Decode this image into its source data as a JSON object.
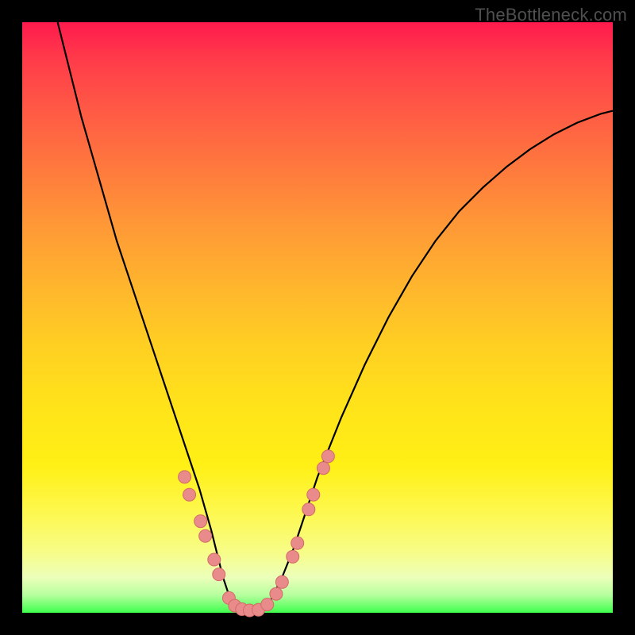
{
  "watermark": {
    "text": "TheBottleneck.com"
  },
  "colors": {
    "frame": "#000000",
    "curve_stroke": "#000000",
    "marker_fill": "#e88b8a",
    "marker_stroke": "#d46a6a"
  },
  "chart_data": {
    "type": "line",
    "title": "",
    "xlabel": "",
    "ylabel": "",
    "xlim": [
      0,
      100
    ],
    "ylim": [
      0,
      100
    ],
    "grid": false,
    "legend": false,
    "series": [
      {
        "name": "bottleneck-curve",
        "x": [
          6,
          8,
          10,
          12,
          14,
          16,
          18,
          20,
          22,
          24,
          26,
          28,
          30,
          32,
          33,
          34,
          35,
          36,
          38,
          40,
          42,
          44,
          46,
          48,
          50,
          54,
          58,
          62,
          66,
          70,
          74,
          78,
          82,
          86,
          90,
          94,
          98,
          100
        ],
        "values": [
          100,
          92,
          84,
          77,
          70,
          63,
          57,
          51,
          45,
          39,
          33,
          27,
          21,
          14,
          10,
          6,
          3,
          1,
          0,
          0,
          2,
          6,
          11,
          17,
          23,
          33,
          42,
          50,
          57,
          63,
          68,
          72,
          75.5,
          78.5,
          81,
          83,
          84.5,
          85
        ]
      }
    ],
    "markers": [
      {
        "x": 27.5,
        "y": 23
      },
      {
        "x": 28.3,
        "y": 20
      },
      {
        "x": 30.2,
        "y": 15.5
      },
      {
        "x": 31.0,
        "y": 13
      },
      {
        "x": 32.5,
        "y": 9
      },
      {
        "x": 33.3,
        "y": 6.5
      },
      {
        "x": 35.0,
        "y": 2.5
      },
      {
        "x": 36.0,
        "y": 1.2
      },
      {
        "x": 37.2,
        "y": 0.6
      },
      {
        "x": 38.5,
        "y": 0.4
      },
      {
        "x": 40.0,
        "y": 0.5
      },
      {
        "x": 41.5,
        "y": 1.4
      },
      {
        "x": 43.0,
        "y": 3.2
      },
      {
        "x": 44.0,
        "y": 5.2
      },
      {
        "x": 45.8,
        "y": 9.5
      },
      {
        "x": 46.6,
        "y": 11.8
      },
      {
        "x": 48.5,
        "y": 17.5
      },
      {
        "x": 49.3,
        "y": 20
      },
      {
        "x": 51.0,
        "y": 24.5
      },
      {
        "x": 51.8,
        "y": 26.5
      }
    ]
  }
}
